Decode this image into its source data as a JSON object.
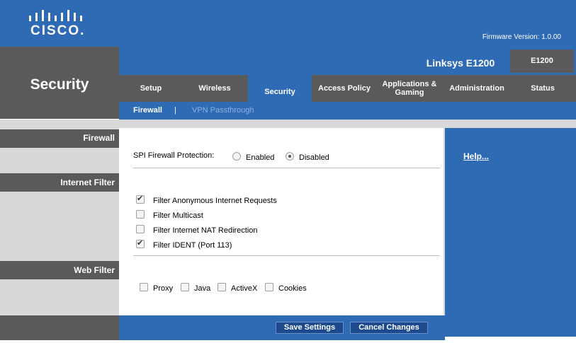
{
  "brand": {
    "logo_text": "CISCO."
  },
  "header": {
    "firmware_label": "Firmware Version:",
    "firmware_version": "1.0.00"
  },
  "product": {
    "name": "Linksys E1200",
    "model": "E1200"
  },
  "page": {
    "title": "Security"
  },
  "tabs": [
    {
      "label": "Setup",
      "active": false
    },
    {
      "label": "Wireless",
      "active": false
    },
    {
      "label": "Security",
      "active": true
    },
    {
      "label": "Access Policy",
      "active": false
    },
    {
      "label": "Applications & Gaming",
      "active": false
    },
    {
      "label": "Administration",
      "active": false
    },
    {
      "label": "Status",
      "active": false
    }
  ],
  "subnav": {
    "items": [
      "Firewall",
      "VPN Passthrough"
    ],
    "separator": "|",
    "active": "Firewall"
  },
  "sections": {
    "firewall": "Firewall",
    "internet_filter": "Internet Filter",
    "web_filter": "Web Filter"
  },
  "firewall": {
    "spi_label": "SPI Firewall Protection:",
    "options": [
      "Enabled",
      "Disabled"
    ],
    "selected": "Disabled"
  },
  "internet_filter": [
    {
      "label": "Filter Anonymous Internet Requests",
      "checked": true
    },
    {
      "label": "Filter Multicast",
      "checked": false
    },
    {
      "label": "Filter Internet NAT Redirection",
      "checked": false
    },
    {
      "label": "Filter IDENT (Port 113)",
      "checked": true
    }
  ],
  "web_filter": [
    {
      "label": "Proxy",
      "checked": false
    },
    {
      "label": "Java",
      "checked": false
    },
    {
      "label": "ActiveX",
      "checked": false
    },
    {
      "label": "Cookies",
      "checked": false
    }
  ],
  "help": {
    "label": "Help..."
  },
  "buttons": {
    "save": "Save Settings",
    "cancel": "Cancel Changes"
  },
  "colors": {
    "brand_blue": "#2f6bb5",
    "dark_gray": "#5a5a5a",
    "light_gray": "#d8d8d8",
    "button_blue": "#1c4a8c"
  }
}
